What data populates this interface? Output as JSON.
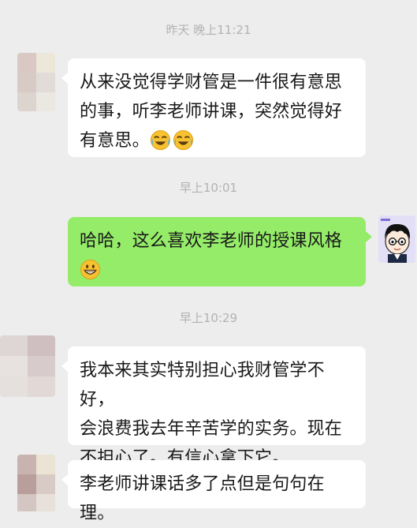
{
  "timestamps": {
    "t1": "昨天 晚上11:21",
    "t2": "早上10:01",
    "t3": "早上10:29"
  },
  "messages": [
    {
      "side": "left",
      "lines": [
        "从来没觉得学财管是一件很有意思",
        "的事，听李老师讲课，突然觉得好",
        "有意思。"
      ],
      "emoji": "crying-laughing-emoji"
    },
    {
      "side": "right",
      "lines": [
        "哈哈，这么喜欢李老师的授课风格"
      ],
      "emoji": "grinning-emoji"
    },
    {
      "side": "left",
      "lines": [
        "我本来其实特别担心我财管学不好，",
        "会浪费我去年辛苦学的实务。现在",
        "不担心了。有信心拿下它。"
      ]
    },
    {
      "side": "left",
      "lines": [
        "李老师讲课话多了点但是句句在理。"
      ]
    }
  ],
  "colors": {
    "background": "#ededed",
    "bubble_incoming": "#ffffff",
    "bubble_outgoing": "#95ec69",
    "timestamp_text": "#b2b2b2"
  },
  "icons": {
    "contact_avatar": "blurred-avatar-icon",
    "user_avatar": "cartoon-boy-avatar-icon"
  }
}
